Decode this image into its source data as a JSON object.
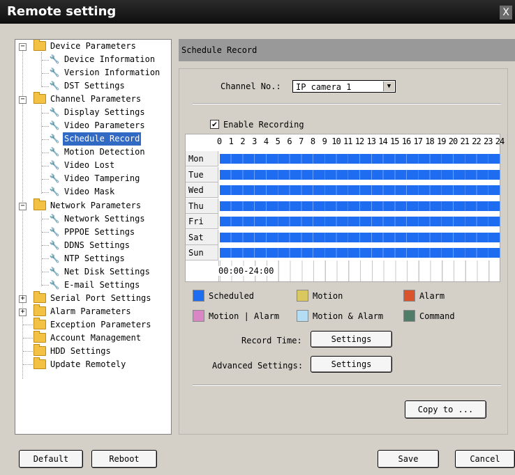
{
  "window": {
    "title": "Remote setting",
    "close_glyph": "X"
  },
  "tree": {
    "device_parameters": "Device Parameters",
    "device_information": "Device Information",
    "version_information": "Version Information",
    "dst_settings": "DST Settings",
    "channel_parameters": "Channel Parameters",
    "display_settings": "Display Settings",
    "video_parameters": "Video Parameters",
    "schedule_record": "Schedule Record",
    "motion_detection": "Motion Detection",
    "video_lost": "Video Lost",
    "video_tampering": "Video Tampering",
    "video_mask": "Video Mask",
    "network_parameters": "Network Parameters",
    "network_settings": "Network Settings",
    "pppoe_settings": "PPPOE Settings",
    "ddns_settings": "DDNS Settings",
    "ntp_settings": "NTP Settings",
    "net_disk_settings": "Net Disk Settings",
    "email_settings": "E-mail Settings",
    "serial_port_settings": "Serial Port Settings",
    "alarm_parameters": "Alarm Parameters",
    "exception_parameters": "Exception Parameters",
    "account_management": "Account Management",
    "hdd_settings": "HDD Settings",
    "update_remotely": "Update Remotely",
    "minus": "−",
    "plus": "+"
  },
  "panel": {
    "header": "Schedule Record",
    "channel_label": "Channel No.:",
    "channel_value": "IP camera 1",
    "enable_recording": "Enable Recording",
    "enable_checked": "✔",
    "hours": [
      "0",
      "1",
      "2",
      "3",
      "4",
      "5",
      "6",
      "7",
      "8",
      "9",
      "10",
      "11",
      "12",
      "13",
      "14",
      "15",
      "16",
      "17",
      "18",
      "19",
      "20",
      "21",
      "22",
      "23",
      "24"
    ],
    "days": [
      "Mon",
      "Tue",
      "Wed",
      "Thu",
      "Fri",
      "Sat",
      "Sun"
    ],
    "time_range": "00:00-24:00",
    "legend": {
      "scheduled": "Scheduled",
      "motion": "Motion",
      "alarm": "Alarm",
      "motion_or_alarm": "Motion | Alarm",
      "motion_and_alarm": "Motion & Alarm",
      "command": "Command"
    },
    "legend_colors": {
      "scheduled": "#1e6cf0",
      "motion": "#d9c760",
      "alarm": "#d9542a",
      "motion_or_alarm": "#db86c4",
      "motion_and_alarm": "#b4dcf4",
      "command": "#4f7d67"
    },
    "record_time_label": "Record Time:",
    "advanced_label": "Advanced Settings:",
    "settings_btn": "Settings",
    "copy_btn": "Copy to ..."
  },
  "footer": {
    "default": "Default",
    "reboot": "Reboot",
    "save": "Save",
    "cancel": "Cancel"
  }
}
